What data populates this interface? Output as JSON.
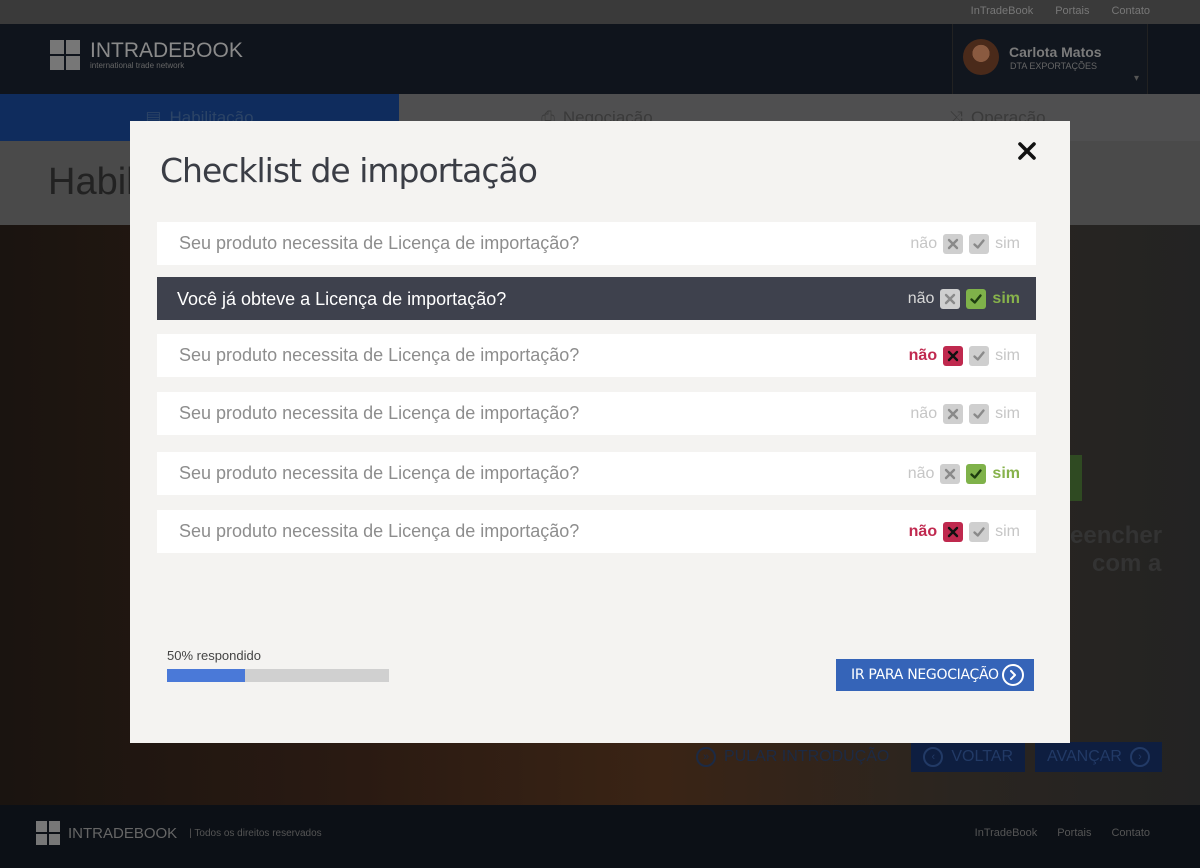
{
  "top_links": [
    "InTradeBook",
    "Portais",
    "Contato"
  ],
  "brand": {
    "name": "INTRADEBOOK",
    "tagline": "international trade network"
  },
  "user": {
    "name": "Carlota Matos",
    "role": "DTA EXPORTAÇÕES"
  },
  "nav": {
    "tabs": [
      {
        "label": "Habilitação",
        "icon": "document-icon"
      },
      {
        "label": "Negociação",
        "icon": "printer-icon"
      },
      {
        "label": "Operação",
        "icon": "shuffle-icon"
      }
    ]
  },
  "page": {
    "title": "Habili",
    "bg_text_1": "eencher",
    "bg_text_2": "com a"
  },
  "bg_controls": {
    "skip": "PULAR INTRODUÇÃO",
    "back": "VOLTAR",
    "next": "AVANÇAR"
  },
  "footer": {
    "brand": "INTRADEBOOK",
    "rights": "| Todos os direitos reservados",
    "links": [
      "InTradeBook",
      "Portais",
      "Contato"
    ]
  },
  "modal": {
    "title": "Checklist de importação",
    "close_icon": "close-icon",
    "no_label": "não",
    "yes_label": "sim",
    "questions": [
      {
        "text": "Seu produto necessita de Licença de importação?",
        "answer": null,
        "selected": false
      },
      {
        "text": "Você já obteve a Licença de importação?",
        "answer": "sim",
        "selected": true
      },
      {
        "text": "Seu produto necessita de Licença de importação?",
        "answer": "não",
        "selected": false
      },
      {
        "text": "Seu produto necessita de Licença de importação?",
        "answer": null,
        "selected": false
      },
      {
        "text": "Seu produto necessita de Licença de importação?",
        "answer": "sim",
        "selected": false
      },
      {
        "text": "Seu produto necessita de Licença de importação?",
        "answer": "não",
        "selected": false
      }
    ],
    "progress": {
      "label": "50% respondido",
      "fraction": 0.35
    },
    "next_button": "IR PARA NEGOCIAÇÃO"
  },
  "colors": {
    "accent": "#3564b8",
    "no": "#bf294e",
    "yes": "#7fb24a",
    "selected_row": "#3e414d"
  }
}
